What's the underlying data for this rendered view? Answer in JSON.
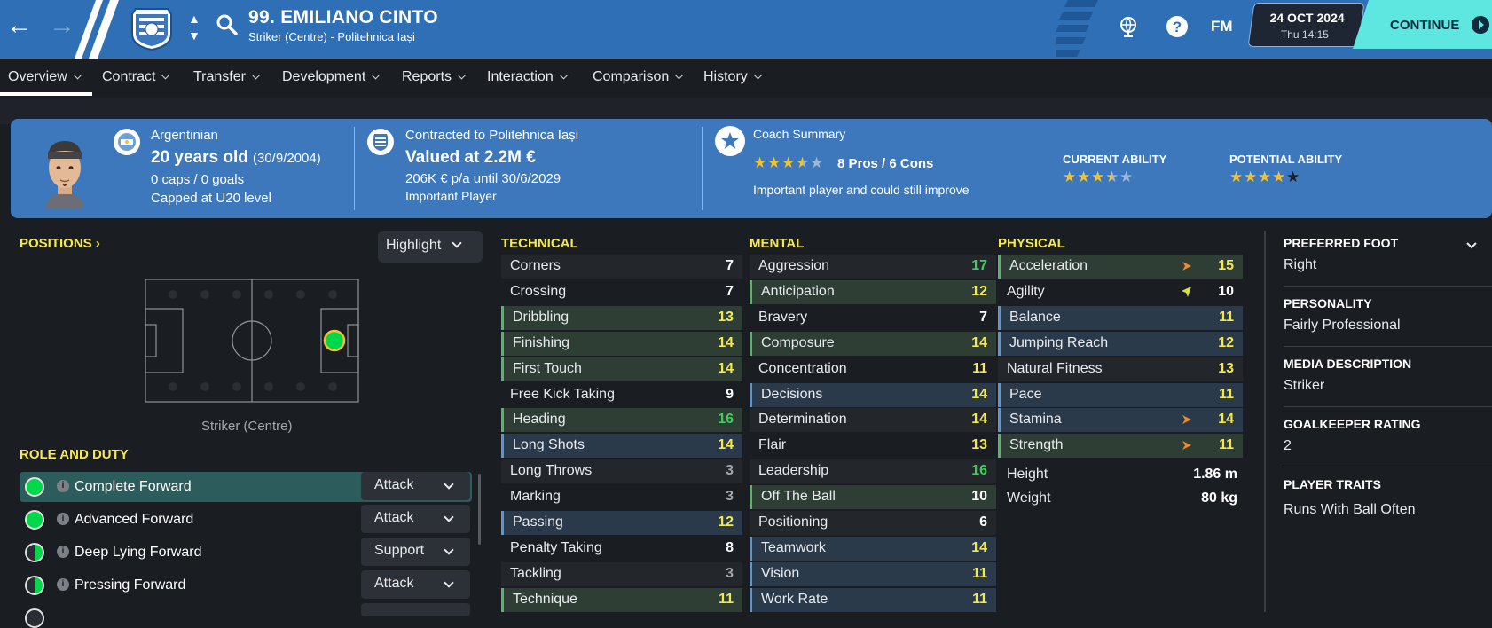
{
  "header": {
    "player_title": "99. EMILIANO CINTO",
    "player_subtitle": "Striker (Centre) - Politehnica Iași",
    "fm_logo": "FM",
    "date": "24 OCT 2024",
    "time": "Thu 14:15",
    "continue_label": "CONTINUE",
    "brand_color": "#2f6fb5",
    "continue_color": "#5ee7e0"
  },
  "tabs": [
    {
      "label": "Overview"
    },
    {
      "label": "Contract"
    },
    {
      "label": "Transfer"
    },
    {
      "label": "Development"
    },
    {
      "label": "Reports"
    },
    {
      "label": "Interaction"
    },
    {
      "label": "Comparison"
    },
    {
      "label": "History"
    }
  ],
  "info": {
    "nationality": "Argentinian",
    "age": "20 years old",
    "dob": "(30/9/2004)",
    "caps": "0 caps / 0 goals",
    "capped": "Capped at U20 level",
    "contract": "Contracted to Politehnica Iași",
    "value": "Valued at 2.2M €",
    "wage": "206K € p/a until 30/6/2029",
    "squad_status": "Important Player",
    "coach_summary_title": "Coach Summary",
    "pros_cons": "8 Pros / 6 Cons",
    "coach_summary_text": "Important player and could still improve",
    "coach_stars": 3.5,
    "current_ability_label": "CURRENT ABILITY",
    "current_ability_stars": 3.5,
    "potential_ability_label": "POTENTIAL ABILITY",
    "potential_ability_stars": 5
  },
  "positions": {
    "heading": "POSITIONS",
    "highlight_label": "Highlight",
    "position_label": "Striker (Centre)"
  },
  "roles": {
    "heading": "ROLE AND DUTY",
    "items": [
      {
        "name": "Complete Forward",
        "duty": "Attack",
        "suitability": "full"
      },
      {
        "name": "Advanced Forward",
        "duty": "Attack",
        "suitability": "full"
      },
      {
        "name": "Deep Lying Forward",
        "duty": "Support",
        "suitability": "partial"
      },
      {
        "name": "Pressing Forward",
        "duty": "Attack",
        "suitability": "partial"
      }
    ]
  },
  "technical": {
    "heading": "TECHNICAL",
    "attrs": [
      {
        "name": "Corners",
        "value": "7",
        "style": "dark",
        "color": "white"
      },
      {
        "name": "Crossing",
        "value": "7",
        "style": "none",
        "color": "white"
      },
      {
        "name": "Dribbling",
        "value": "13",
        "style": "green",
        "color": "yellow"
      },
      {
        "name": "Finishing",
        "value": "14",
        "style": "green",
        "color": "yellow"
      },
      {
        "name": "First Touch",
        "value": "14",
        "style": "green",
        "color": "yellow"
      },
      {
        "name": "Free Kick Taking",
        "value": "9",
        "style": "none",
        "color": "white"
      },
      {
        "name": "Heading",
        "value": "16",
        "style": "green",
        "color": "green"
      },
      {
        "name": "Long Shots",
        "value": "14",
        "style": "blue",
        "color": "yellow"
      },
      {
        "name": "Long Throws",
        "value": "3",
        "style": "dark",
        "color": "grey"
      },
      {
        "name": "Marking",
        "value": "3",
        "style": "none",
        "color": "grey"
      },
      {
        "name": "Passing",
        "value": "12",
        "style": "blue",
        "color": "yellow"
      },
      {
        "name": "Penalty Taking",
        "value": "8",
        "style": "none",
        "color": "white"
      },
      {
        "name": "Tackling",
        "value": "3",
        "style": "dark",
        "color": "grey"
      },
      {
        "name": "Technique",
        "value": "11",
        "style": "green",
        "color": "yellow"
      }
    ]
  },
  "mental": {
    "heading": "MENTAL",
    "attrs": [
      {
        "name": "Aggression",
        "value": "17",
        "style": "dark",
        "color": "green"
      },
      {
        "name": "Anticipation",
        "value": "12",
        "style": "green",
        "color": "yellow"
      },
      {
        "name": "Bravery",
        "value": "7",
        "style": "none",
        "color": "white"
      },
      {
        "name": "Composure",
        "value": "14",
        "style": "green",
        "color": "yellow"
      },
      {
        "name": "Concentration",
        "value": "11",
        "style": "none",
        "color": "yellow"
      },
      {
        "name": "Decisions",
        "value": "14",
        "style": "blue",
        "color": "yellow"
      },
      {
        "name": "Determination",
        "value": "14",
        "style": "dark",
        "color": "yellow"
      },
      {
        "name": "Flair",
        "value": "13",
        "style": "none",
        "color": "yellow"
      },
      {
        "name": "Leadership",
        "value": "16",
        "style": "dark",
        "color": "green"
      },
      {
        "name": "Off The Ball",
        "value": "10",
        "style": "green",
        "color": "white"
      },
      {
        "name": "Positioning",
        "value": "6",
        "style": "dark",
        "color": "white"
      },
      {
        "name": "Teamwork",
        "value": "14",
        "style": "blue",
        "color": "yellow"
      },
      {
        "name": "Vision",
        "value": "11",
        "style": "blue",
        "color": "yellow"
      },
      {
        "name": "Work Rate",
        "value": "11",
        "style": "blue",
        "color": "yellow"
      }
    ]
  },
  "physical": {
    "heading": "PHYSICAL",
    "attrs": [
      {
        "name": "Acceleration",
        "value": "15",
        "style": "green",
        "color": "yellow",
        "trend": "up-orange"
      },
      {
        "name": "Agility",
        "value": "10",
        "style": "none",
        "color": "white",
        "trend": "up-yellow"
      },
      {
        "name": "Balance",
        "value": "11",
        "style": "blue",
        "color": "yellow",
        "trend": ""
      },
      {
        "name": "Jumping Reach",
        "value": "12",
        "style": "blue",
        "color": "yellow",
        "trend": ""
      },
      {
        "name": "Natural Fitness",
        "value": "13",
        "style": "dark",
        "color": "yellow",
        "trend": ""
      },
      {
        "name": "Pace",
        "value": "11",
        "style": "blue",
        "color": "yellow",
        "trend": ""
      },
      {
        "name": "Stamina",
        "value": "14",
        "style": "blue",
        "color": "yellow",
        "trend": "up-orange"
      },
      {
        "name": "Strength",
        "value": "11",
        "style": "green",
        "color": "yellow",
        "trend": "up-orange"
      }
    ],
    "height_label": "Height",
    "height_value": "1.86 m",
    "weight_label": "Weight",
    "weight_value": "80 kg"
  },
  "side": {
    "preferred_foot_label": "PREFERRED FOOT",
    "preferred_foot": "Right",
    "personality_label": "PERSONALITY",
    "personality": "Fairly Professional",
    "media_label": "MEDIA DESCRIPTION",
    "media": "Striker",
    "gk_label": "GOALKEEPER RATING",
    "gk": "2",
    "traits_label": "PLAYER TRAITS",
    "traits": "Runs With Ball Often"
  }
}
